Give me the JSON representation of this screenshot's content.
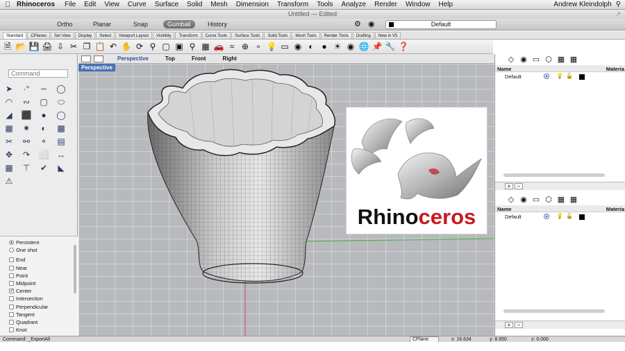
{
  "menubar": {
    "app_name": "Rhinoceros",
    "items": [
      "File",
      "Edit",
      "View",
      "Curve",
      "Surface",
      "Solid",
      "Mesh",
      "Dimension",
      "Transform",
      "Tools",
      "Analyze",
      "Render",
      "Window",
      "Help"
    ],
    "user": "Andrew Kleindolph"
  },
  "window": {
    "title": "Untitled — Edited"
  },
  "modes": {
    "ortho": "Ortho",
    "planar": "Planar",
    "snap": "Snap",
    "gumball": "Gumball",
    "history": "History",
    "layer": "Default"
  },
  "tabs": [
    "Standard",
    "CPlanes",
    "Set View",
    "Display",
    "Select",
    "Viewport Layout",
    "Visibility",
    "Transform",
    "Curve Tools",
    "Surface Tools",
    "Solid Tools",
    "Mesh Tools",
    "Render Tools",
    "Drafting",
    "New in V5"
  ],
  "viewports": {
    "perspective": "Perspective",
    "top": "Top",
    "front": "Front",
    "right": "Right",
    "active_label": "Perspective"
  },
  "command": {
    "placeholder": "Command"
  },
  "osnap": {
    "persistent": "Persistent",
    "one_shot": "One shot",
    "items": [
      "End",
      "Near",
      "Point",
      "Midpoint",
      "Center",
      "Intersection",
      "Perpendicular",
      "Tangent",
      "Quadrant",
      "Knot"
    ],
    "checked": "Center"
  },
  "layers": {
    "col_name": "Name",
    "col_material": "Materia",
    "row_name": "Default",
    "add": "+",
    "remove": "−"
  },
  "logo": {
    "text_main": "Rhino",
    "text_accent": "ceros"
  },
  "status": {
    "command": "Command: _ExportAll",
    "cplane": "CPlane",
    "x": "x: 16.634",
    "y": "y: 8.650",
    "z": "z: 0.000"
  },
  "colors": {
    "active_tab": "#4a6fb5",
    "logo_accent": "#c8191e",
    "green_axis": "#3fae3f",
    "red_axis": "#c0504d"
  }
}
